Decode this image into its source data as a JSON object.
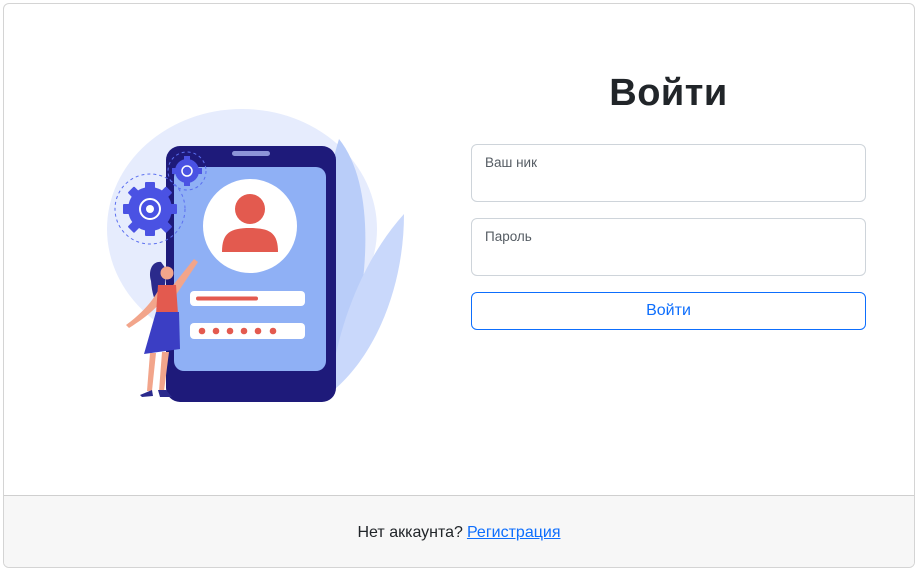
{
  "login": {
    "title": "Войти",
    "nick_label": "Ваш ник",
    "nick_value": "",
    "password_label": "Пароль",
    "password_value": "",
    "submit_label": "Войти"
  },
  "footer": {
    "prompt": "Нет аккаунта?",
    "register_link": "Регистрация"
  },
  "colors": {
    "primary": "#0d6efd",
    "illustration_accent": "#e35a4f",
    "illustration_phone": "#1e1a7a",
    "illustration_screen": "#8fb0f5"
  },
  "illustration": {
    "icons": [
      "gear-icon",
      "user-avatar-icon",
      "leaf-icon"
    ]
  }
}
